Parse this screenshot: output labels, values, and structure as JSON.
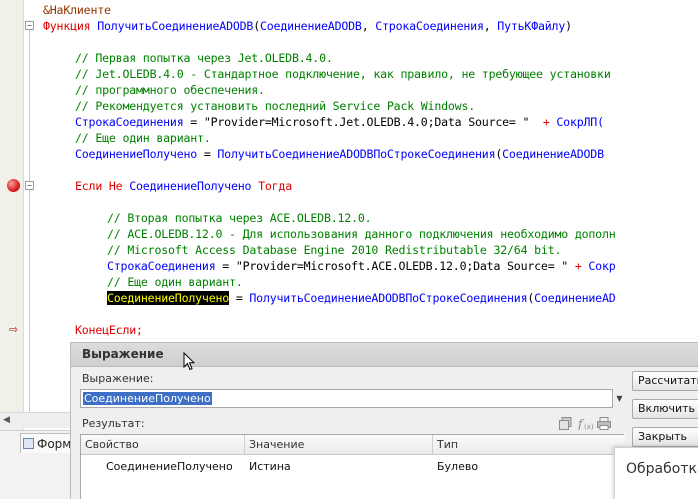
{
  "editor": {
    "lines": [
      {
        "text": "&НаКлиенте",
        "style": "pp",
        "indent": 0
      },
      {
        "text": "Функция ПолучитьСоединениеADODB(СоединениеADODB, СтрокаСоединения, ПутьКФайлу)",
        "style": "func",
        "indent": 0
      },
      {
        "text": "",
        "style": "blank",
        "indent": 0
      },
      {
        "text": "// Первая попытка через Jet.OLEDB.4.0.",
        "style": "cm",
        "indent": 1
      },
      {
        "text": "// Jet.OLEDB.4.0 - Стандартное подключение, как правило, не требующее установки",
        "style": "cm",
        "indent": 1
      },
      {
        "text": "// программного обеспечения.",
        "style": "cm",
        "indent": 1
      },
      {
        "text": "// Рекомендуется установить последний Service Pack Windows.",
        "style": "cm",
        "indent": 1
      },
      {
        "text": "СтрокаСоединения = \"Provider=Microsoft.Jet.OLEDB.4.0;Data Source= \"  + СокрЛП(",
        "style": "assign",
        "indent": 1
      },
      {
        "text": "// Еще один вариант.",
        "style": "cm",
        "indent": 1
      },
      {
        "text": "СоединениеПолучено = ПолучитьСоединениеADODBПоСтрокеСоединения(СоединениеADODB",
        "style": "id",
        "indent": 1
      },
      {
        "text": "",
        "style": "blank",
        "indent": 0
      },
      {
        "text": "Если Не СоединениеПолучено Тогда",
        "style": "if",
        "indent": 1
      },
      {
        "text": "",
        "style": "blank",
        "indent": 0
      },
      {
        "text": "// Вторая попытка через ACE.OLEDB.12.0.",
        "style": "cm",
        "indent": 2
      },
      {
        "text": "// ACE.OLEDB.12.0 - Для использования данного подключения необходимо дополн",
        "style": "cm",
        "indent": 2
      },
      {
        "text": "// Microsoft Access Database Engine 2010 Redistributable 32/64 bit.",
        "style": "cm",
        "indent": 2
      },
      {
        "text": "СтрокаСоединения = \"Provider=Microsoft.ACE.OLEDB.12.0;Data Source= \" + Сокр",
        "style": "assign",
        "indent": 2
      },
      {
        "text": "// Еще один вариант.",
        "style": "cm",
        "indent": 2
      },
      {
        "text": "СоединениеПолучено = ПолучитьСоединениеADODBПоСтрокеСоединения(СоединениеAD",
        "style": "hlid",
        "indent": 2
      },
      {
        "text": "",
        "style": "blank",
        "indent": 0
      },
      {
        "text": "КонецЕсли;",
        "style": "kw",
        "indent": 1
      }
    ],
    "fold_minus": "−"
  },
  "bottom_tab": {
    "label": "Форма"
  },
  "dialog": {
    "title": "Выражение",
    "expression_label": "Выражение:",
    "expression_value": "СоединениеПолучено",
    "result_label": "Результат:",
    "buttons": {
      "calculate": "Рассчитать",
      "add_to_table": "Включить в табло",
      "close": "Закрыть"
    },
    "columns": [
      "Свойство",
      "Значение",
      "Тип"
    ],
    "rows": [
      {
        "property": "СоединениеПолучено",
        "value": "Истина",
        "type": "Булево"
      }
    ],
    "icons": [
      "copy-icon",
      "function-icon",
      "print-icon"
    ]
  },
  "processing_popup": {
    "text": "Обработка"
  },
  "colors": {
    "keyword": "#e00000",
    "comment": "#008000",
    "identifier": "#0000ff",
    "preprocessor": "#963200",
    "selection": "#3c6fc5",
    "highlight_bg": "#000000",
    "highlight_fg": "#ffff00"
  }
}
